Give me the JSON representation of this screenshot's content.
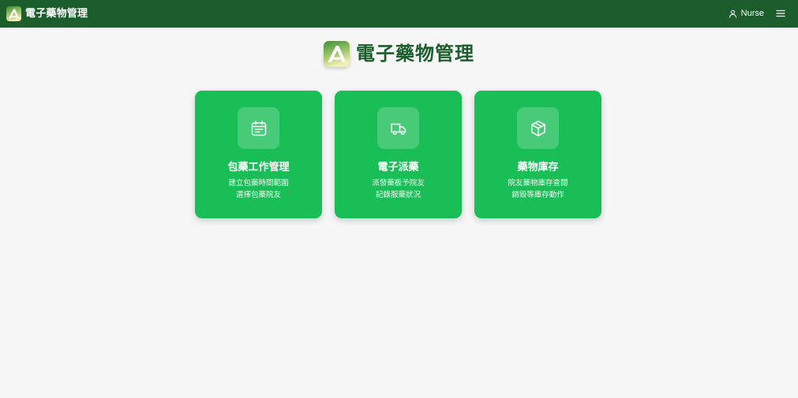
{
  "app": {
    "brand_name": "電子藥物管理",
    "logo_icon": "app-logo-a-icon",
    "user_name": "Nurse",
    "user_icon": "user-icon",
    "menu_icon": "hamburger-menu-icon"
  },
  "page": {
    "title": "電子藥物管理"
  },
  "cards": [
    {
      "title": "包藥工作管理",
      "desc_line1": "建立包藥時間範圍",
      "desc_line2": "選擇包藥院友",
      "icon": "calendar-icon"
    },
    {
      "title": "電子派藥",
      "desc_line1": "派發藥板予院友",
      "desc_line2": "記錄服藥狀況",
      "icon": "truck-icon"
    },
    {
      "title": "藥物庫存",
      "desc_line1": "院友藥物庫存查閱",
      "desc_line2": "銷毀等庫存動作",
      "icon": "package-box-icon"
    }
  ],
  "colors": {
    "topbar": "#1b5e2b",
    "page_background": "#f6f6f6",
    "card_background": "#1abe57",
    "title_text": "#1b5e2b",
    "logo_gradient_top": "#3f8e3a",
    "logo_gradient_bottom": "#f0eeb4"
  }
}
